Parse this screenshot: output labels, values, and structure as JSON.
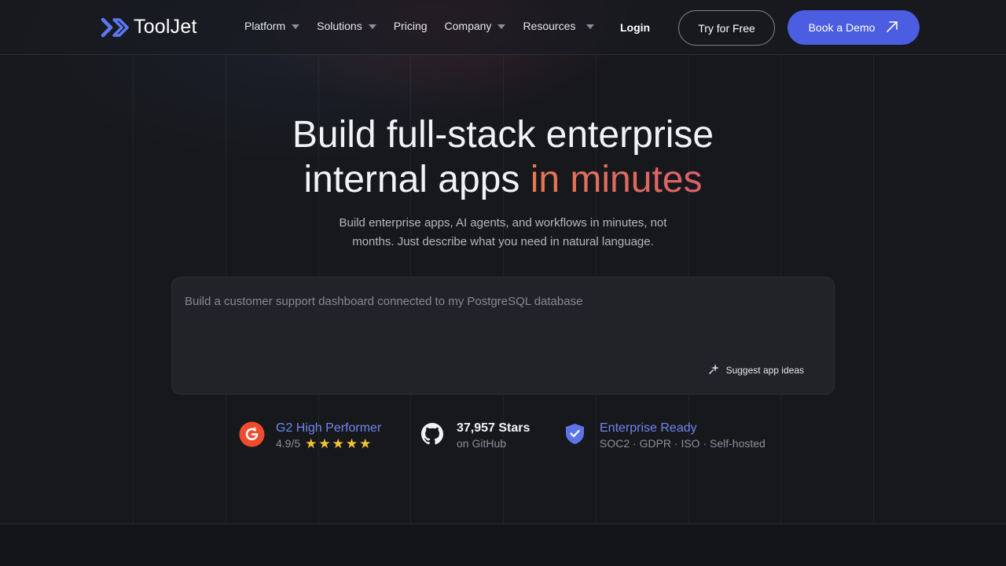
{
  "nav": {
    "logo_text": "ToolJet",
    "items": [
      {
        "label": "Platform",
        "dropdown": true
      },
      {
        "label": "Solutions",
        "dropdown": true
      },
      {
        "label": "Pricing",
        "dropdown": false
      },
      {
        "label": "Company",
        "dropdown": true
      },
      {
        "label": "Resources",
        "dropdown": true
      }
    ],
    "login": "Login",
    "try_free": "Try for Free",
    "book_demo": "Book a Demo"
  },
  "hero": {
    "title_line1": "Build full-stack enterprise",
    "title_line2_plain": "internal apps ",
    "title_line2_accent": "in minutes",
    "subtitle": "Build enterprise apps, AI agents, and workflows in minutes, not months. Just describe what you need in natural language."
  },
  "prompt": {
    "placeholder": "Build a customer support dashboard connected to my PostgreSQL database",
    "value": "",
    "suggest_label": "Suggest app ideas"
  },
  "badges": {
    "g2": {
      "title": "G2 High Performer",
      "rating": "4.9/5",
      "stars": 5
    },
    "github": {
      "title": "37,957 Stars",
      "subtitle": "on GitHub"
    },
    "enterprise": {
      "title": "Enterprise Ready",
      "subtitle": "SOC2 · GDPR · ISO · Self-hosted"
    }
  },
  "colors": {
    "background": "#17181c",
    "primary": "#4b5de0",
    "accent_start": "#e77854",
    "accent_end": "#d9606a",
    "link": "#6f86f0",
    "g2_red": "#ef4b2f",
    "star": "#f4c431"
  },
  "icons": {
    "logo": "tooljet-chevrons-logo",
    "dropdown": "caret-down-icon",
    "demo_arrow": "arrow-up-right-icon",
    "suggest": "sparkle-icon",
    "g2": "g2-logo-icon",
    "github": "github-icon",
    "enterprise": "shield-check-icon"
  }
}
